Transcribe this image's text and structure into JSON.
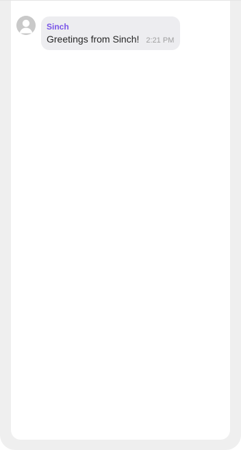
{
  "message": {
    "sender": "Sinch",
    "text": "Greetings from Sinch!",
    "time": "2:21 PM",
    "avatar_icon": "user-avatar-icon"
  },
  "colors": {
    "frame": "#efefef",
    "bubble": "#ededf0",
    "sender": "#7a55e8",
    "time": "#9e9e9e"
  }
}
